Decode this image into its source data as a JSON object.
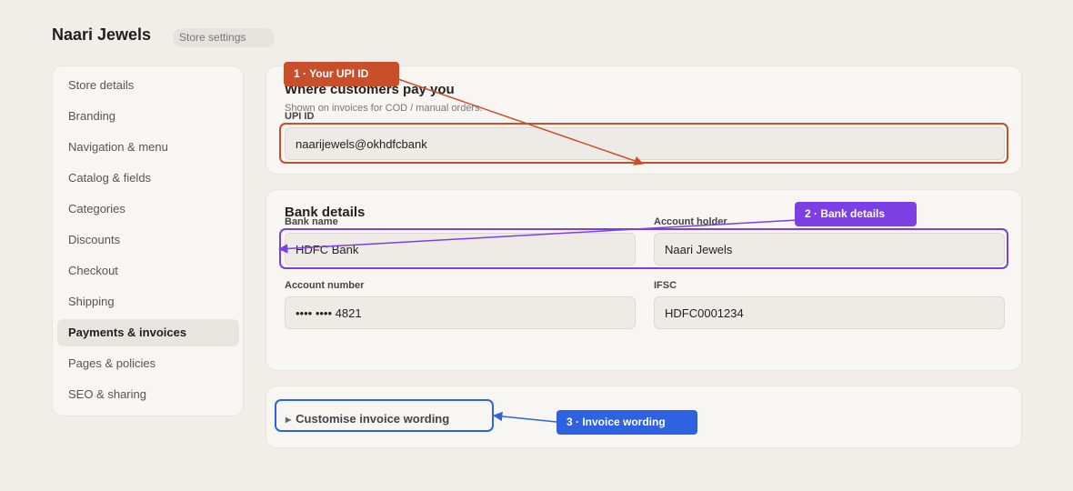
{
  "header": {
    "brand": "Naari Jewels",
    "breadcrumb": "Store settings"
  },
  "sidebar": {
    "items": [
      {
        "label": "Store details"
      },
      {
        "label": "Branding"
      },
      {
        "label": "Navigation & menu"
      },
      {
        "label": "Catalog & fields"
      },
      {
        "label": "Categories"
      },
      {
        "label": "Discounts"
      },
      {
        "label": "Checkout"
      },
      {
        "label": "Shipping"
      },
      {
        "label": "Payments & invoices",
        "active": true
      },
      {
        "label": "Pages & policies"
      },
      {
        "label": "SEO & sharing"
      }
    ]
  },
  "upi_section": {
    "title": "Where customers pay you",
    "subtitle": "Shown on invoices for COD / manual orders.",
    "upi_label": "UPI ID",
    "upi_value": "naarijewels@okhdfcbank"
  },
  "bank_section": {
    "title": "Bank details",
    "bank_name_label": "Bank name",
    "bank_name_value": "HDFC Bank",
    "holder_label": "Account holder",
    "holder_value": "Naari Jewels",
    "account_label": "Account number",
    "account_value": "•••• •••• 4821",
    "ifsc_label": "IFSC",
    "ifsc_value": "HDFC0001234"
  },
  "invoice_section": {
    "toggle_label": "Customise invoice wording"
  },
  "annotations": [
    {
      "label": "1 · Your UPI ID",
      "color": "#c94f2a"
    },
    {
      "label": "2 · Bank details",
      "color": "#7b3fe4"
    },
    {
      "label": "3 · Invoice wording",
      "color": "#2f62e0"
    }
  ]
}
